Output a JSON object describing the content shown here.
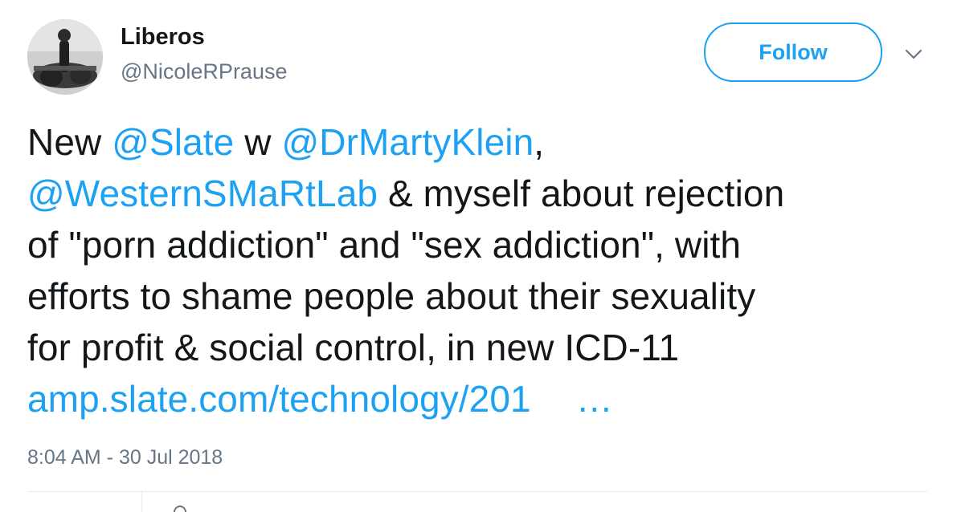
{
  "author": {
    "name": "Liberos",
    "handle": "@NicoleRPrause"
  },
  "follow_label": "Follow",
  "tweet": {
    "l1_a": "New ",
    "l1_m1": "@Slate",
    "l1_b": " w ",
    "l1_m2": "@DrMartyKlein",
    "l1_c": ",",
    "l2_m1": "@WesternSMaRtLab",
    "l2_a": " & myself about rejection",
    "l3": "of \"porn addiction\" and \"sex addiction\", with",
    "l4": "efforts to shame people about their sexuality",
    "l5": "for profit & social control, in new ICD-11",
    "link": "amp.slate.com/technology/201",
    "ellipsis": "…"
  },
  "timestamp": "8:04 AM - 30 Jul 2018",
  "colors": {
    "accent": "#1da1f2",
    "text": "#14171a",
    "muted": "#657786",
    "divider": "#e6ecf0"
  },
  "icons": {
    "menu": "chevron-down-icon",
    "avatar": "profile-photo"
  }
}
